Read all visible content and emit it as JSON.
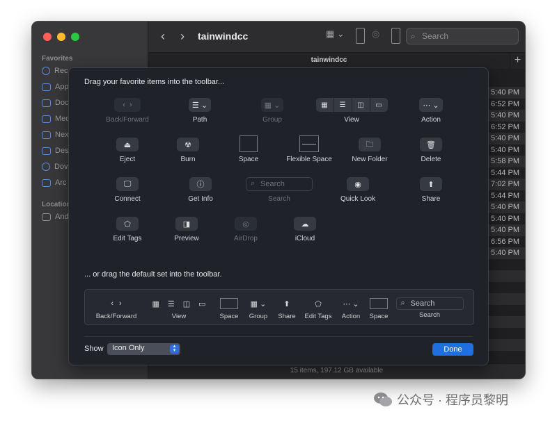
{
  "finder": {
    "title": "tainwindcc",
    "tab_title": "tainwindcc",
    "search_placeholder": "Search",
    "sidebar": {
      "favorites_header": "Favorites",
      "favorites": [
        "Rec",
        "App",
        "Doc",
        "Med",
        "Nex",
        "Des",
        "Dov",
        "Arc"
      ],
      "locations_header": "Location",
      "locations": [
        "And"
      ]
    },
    "times": [
      "5:40 PM",
      "6:52 PM",
      "5:40 PM",
      "6:52 PM",
      "5:40 PM",
      "5:40 PM",
      "5:58 PM",
      "5:44 PM",
      "7:02 PM",
      "5:44 PM",
      "5:40 PM",
      "5:40 PM",
      "5:40 PM",
      "6:56 PM",
      "5:40 PM"
    ],
    "status": "15 items, 197.12 GB available"
  },
  "sheet": {
    "title": "Drag your favorite items into the toolbar...",
    "items": {
      "back_forward": "Back/Forward",
      "path": "Path",
      "group": "Group",
      "view": "View",
      "action": "Action",
      "eject": "Eject",
      "burn": "Burn",
      "space": "Space",
      "flexible_space": "Flexible Space",
      "new_folder": "New Folder",
      "delete": "Delete",
      "connect": "Connect",
      "get_info": "Get Info",
      "search": "Search",
      "search_placeholder": "Search",
      "quick_look": "Quick Look",
      "share": "Share",
      "edit_tags": "Edit Tags",
      "preview": "Preview",
      "airdrop": "AirDrop",
      "icloud": "iCloud"
    },
    "default_title": "... or drag the default set into the toolbar.",
    "default_set": {
      "back_forward": "Back/Forward",
      "view": "View",
      "space1": "Space",
      "group": "Group",
      "share": "Share",
      "edit_tags": "Edit Tags",
      "action": "Action",
      "space2": "Space",
      "search": "Search",
      "search_placeholder": "Search"
    },
    "show_label": "Show",
    "show_value": "Icon Only",
    "done_label": "Done"
  },
  "watermark": "公众号 · 程序员黎明",
  "colors": {
    "accent": "#1f6fe0",
    "sheet_bg": "#1f2229",
    "close": "#ff5f57",
    "minimize": "#febc2e",
    "zoom": "#28c840"
  }
}
